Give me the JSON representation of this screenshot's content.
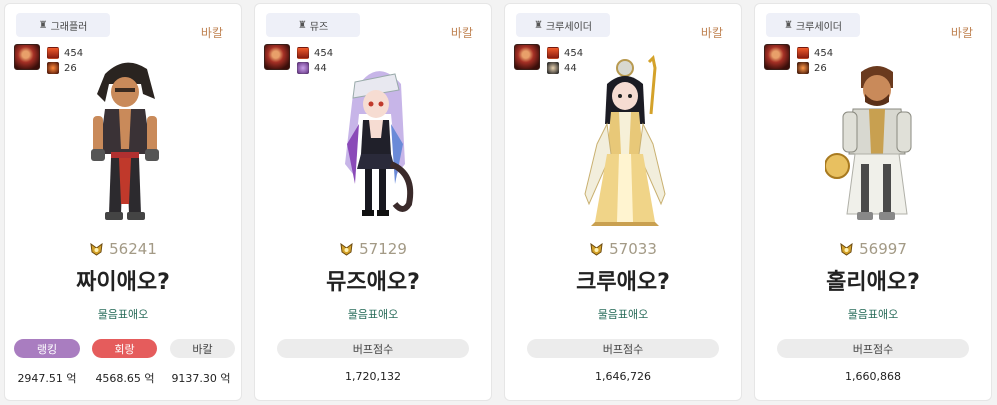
{
  "cards": [
    {
      "job": "그래플러",
      "server": "바칼",
      "stats": [
        {
          "value": "454",
          "icon": "item-level-icon"
        },
        {
          "value": "26",
          "icon": "creature-icon"
        }
      ],
      "fame": "56241",
      "name": "짜이애오?",
      "guild": "물음표애오",
      "pills": [
        {
          "label": "랭킹",
          "value": "2947.51 억",
          "color": "#a97dc0",
          "text_color": "#ffffff"
        },
        {
          "label": "회랑",
          "value": "4568.65 억",
          "color": "#e55c5c",
          "text_color": "#ffffff"
        },
        {
          "label": "바칼",
          "value": "9137.30 억",
          "color": "#ececec",
          "text_color": "#444444"
        }
      ]
    },
    {
      "job": "뮤즈",
      "server": "바칼",
      "stats": [
        {
          "value": "454",
          "icon": "item-level-icon"
        },
        {
          "value": "44",
          "icon": "creature-icon"
        }
      ],
      "fame": "57129",
      "name": "뮤즈애오?",
      "guild": "물음표애오",
      "buff": {
        "label": "버프점수",
        "value": "1,720,132"
      }
    },
    {
      "job": "크루세이더",
      "server": "바칼",
      "stats": [
        {
          "value": "454",
          "icon": "item-level-icon"
        },
        {
          "value": "44",
          "icon": "creature-icon"
        }
      ],
      "fame": "57033",
      "name": "크루애오?",
      "guild": "물음표애오",
      "buff": {
        "label": "버프점수",
        "value": "1,646,726"
      }
    },
    {
      "job": "크루세이더",
      "server": "바칼",
      "stats": [
        {
          "value": "454",
          "icon": "item-level-icon"
        },
        {
          "value": "26",
          "icon": "creature-icon"
        }
      ],
      "fame": "56997",
      "name": "홀리애오?",
      "guild": "물음표애오",
      "buff": {
        "label": "버프점수",
        "value": "1,660,868"
      }
    }
  ],
  "colors": {
    "server": "#c08454",
    "guild": "#2b6e5c",
    "fame": "#a39a86",
    "badge_bg": "#eef0f8"
  }
}
